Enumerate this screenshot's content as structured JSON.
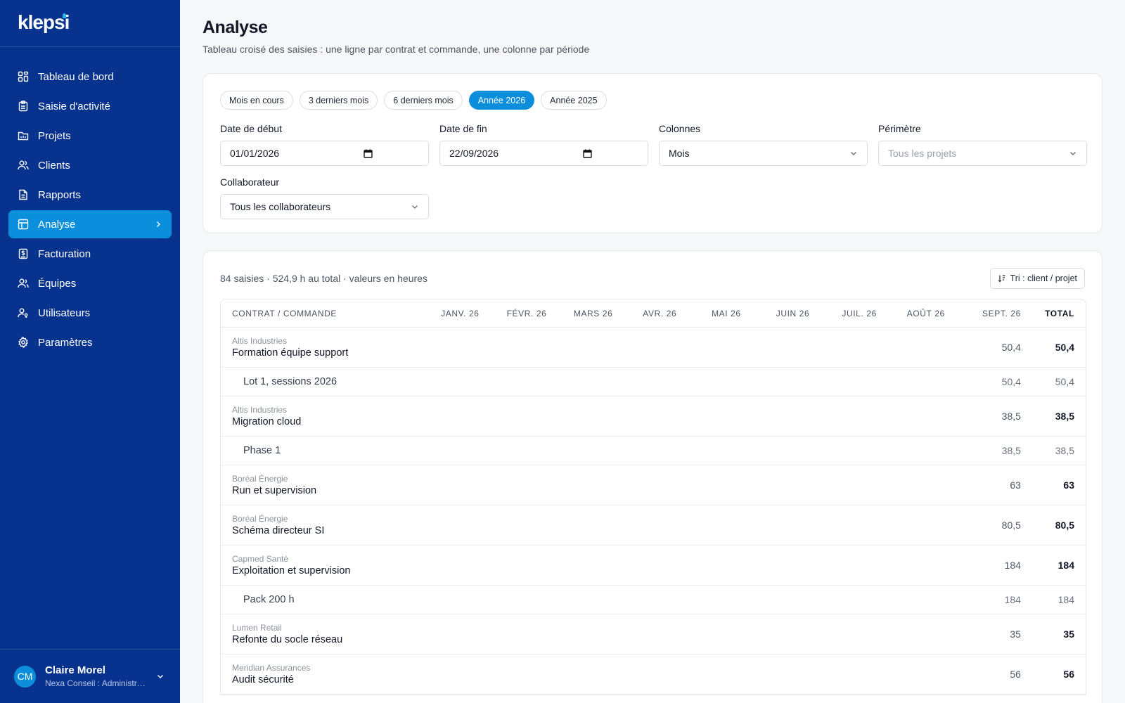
{
  "app": {
    "logo": "klepsi"
  },
  "sidebar": {
    "items": [
      {
        "label": "Tableau de bord",
        "icon": "dashboard-icon"
      },
      {
        "label": "Saisie d'activité",
        "icon": "clipboard-icon"
      },
      {
        "label": "Projets",
        "icon": "folder-icon"
      },
      {
        "label": "Clients",
        "icon": "users-icon"
      },
      {
        "label": "Rapports",
        "icon": "document-icon"
      },
      {
        "label": "Analyse",
        "icon": "table-icon",
        "active": true
      },
      {
        "label": "Facturation",
        "icon": "invoice-icon"
      },
      {
        "label": "Équipes",
        "icon": "team-icon"
      },
      {
        "label": "Utilisateurs",
        "icon": "user-key-icon"
      },
      {
        "label": "Paramètres",
        "icon": "gear-icon"
      }
    ],
    "user": {
      "initials": "CM",
      "name": "Claire Morel",
      "role": "Nexa Conseil : Administr…"
    }
  },
  "header": {
    "title": "Analyse",
    "subtitle": "Tableau croisé des saisies : une ligne par contrat et commande, une colonne par période"
  },
  "filters": {
    "chips": [
      "Mois en cours",
      "3 derniers mois",
      "6 derniers mois",
      "Année 2026",
      "Année 2025"
    ],
    "active_chip": "Année 2026",
    "start_label": "Date de début",
    "start_value": "01/01/2026",
    "end_label": "Date de fin",
    "end_value": "22/09/2026",
    "columns_label": "Colonnes",
    "columns_value": "Mois",
    "scope_label": "Périmètre",
    "scope_placeholder": "Tous les projets",
    "collab_label": "Collaborateur",
    "collab_value": "Tous les collaborateurs"
  },
  "table": {
    "summary": "84 saisies · 524,9 h au total · valeurs en heures",
    "sort_label": "Tri : client / projet",
    "headers": {
      "name": "CONTRAT / COMMANDE",
      "months": [
        "JANV. 26",
        "FÉVR. 26",
        "MARS 26",
        "AVR. 26",
        "MAI 26",
        "JUIN 26",
        "JUIL. 26",
        "AOÛT 26"
      ],
      "sept": "SEPT. 26",
      "total": "TOTAL"
    },
    "rows": [
      {
        "type": "contract",
        "client": "Altis Industries",
        "name": "Formation équipe support",
        "sept": "50,4",
        "total": "50,4"
      },
      {
        "type": "order",
        "name": "Lot 1, sessions 2026",
        "sept": "50,4",
        "total": "50,4"
      },
      {
        "type": "contract",
        "client": "Altis Industries",
        "name": "Migration cloud",
        "sept": "38,5",
        "total": "38,5"
      },
      {
        "type": "order",
        "name": "Phase 1",
        "sept": "38,5",
        "total": "38,5"
      },
      {
        "type": "contract",
        "client": "Boréal Énergie",
        "name": "Run et supervision",
        "sept": "63",
        "total": "63"
      },
      {
        "type": "contract",
        "client": "Boréal Énergie",
        "name": "Schéma directeur SI",
        "sept": "80,5",
        "total": "80,5"
      },
      {
        "type": "contract",
        "client": "Capmed Santé",
        "name": "Exploitation et supervision",
        "sept": "184",
        "total": "184"
      },
      {
        "type": "order",
        "name": "Pack 200 h",
        "sept": "184",
        "total": "184"
      },
      {
        "type": "contract",
        "client": "Lumen Retail",
        "name": "Refonte du socle réseau",
        "sept": "35",
        "total": "35"
      },
      {
        "type": "contract",
        "client": "Meridian Assurances",
        "name": "Audit sécurité",
        "sept": "56",
        "total": "56"
      }
    ]
  },
  "colors": {
    "sidebar_bg": "#07338f",
    "accent": "#0b8fdc",
    "page_bg": "#f7f8fa"
  }
}
